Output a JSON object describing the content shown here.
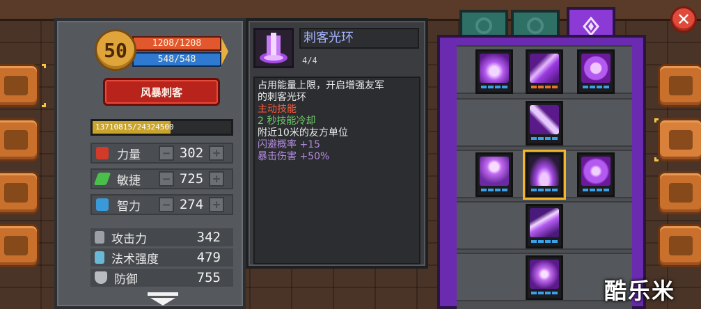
{
  "player": {
    "level": "50",
    "hp": "1208/1208",
    "mp": "548/548",
    "class_name": "风暴刺客",
    "xp_text": "13710815/24324500",
    "xp_fraction": 0.564
  },
  "stats": [
    {
      "label": "力量",
      "value": "302",
      "icon": "strength-fist-icon"
    },
    {
      "label": "敏捷",
      "value": "725",
      "icon": "agility-leaf-icon"
    },
    {
      "label": "智力",
      "value": "274",
      "icon": "intelligence-book-icon"
    }
  ],
  "buttons": {
    "minus": "−",
    "plus": "+"
  },
  "attributes": [
    {
      "label": "攻击力",
      "value": "342",
      "icon": "sword-icon"
    },
    {
      "label": "法术强度",
      "value": "479",
      "icon": "wand-icon"
    },
    {
      "label": "防御",
      "value": "755",
      "icon": "shield-icon"
    }
  ],
  "skill": {
    "title": "刺客光环",
    "level": "4/4",
    "desc_line1": "占用能量上限，开启增强友军",
    "desc_line2": "的刺客光环",
    "type": "主动技能",
    "cooldown": "2 秒技能冷却",
    "range": "附近10米的友方单位",
    "bonus1": "闪避概率 +15",
    "bonus2": "暴击伤害 +50%"
  },
  "colors": {
    "hp": "#e3572e",
    "mp": "#2f7ad0",
    "accent_purple": "#8b3ad6",
    "active_skill_text": "#ff5a3a",
    "cooldown_text": "#6fd06a",
    "desc_text": "#ececec",
    "bonus_text": "#b48be0",
    "selected_frame": "#f3b529"
  },
  "side_tabs": [
    "book-icon",
    "scroll-icon",
    "paw-icon",
    "target-icon"
  ],
  "right_tabs": [
    "helmet-icon",
    "crossed-swords-icon",
    "gear-sun-icon",
    "gear-icon"
  ],
  "tree_tabs": [
    "ring-icon",
    "ring-icon",
    "crystal-icon"
  ],
  "tree_skills": [
    {
      "name": "shockwave-icon",
      "pips": "blue"
    },
    {
      "name": "blade-burst-icon",
      "pips": "orange"
    },
    {
      "name": "heal-plus-icon",
      "pips": "blue"
    },
    {
      "name": "dual-blade-icon",
      "pips": "blue"
    },
    {
      "name": "pet-heart-icon",
      "pips": "blue"
    },
    {
      "name": "aura-pillar-icon",
      "pips": "blue"
    },
    {
      "name": "shield-badge-icon",
      "pips": "blue"
    },
    {
      "name": "lightning-slash-icon",
      "pips": "blue"
    },
    {
      "name": "cross-blades-icon",
      "pips": "blue"
    }
  ],
  "watermark": "酷乐米"
}
